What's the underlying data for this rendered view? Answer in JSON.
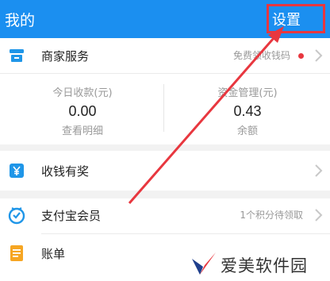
{
  "header": {
    "title": "我的",
    "settings_label": "设置"
  },
  "merchant": {
    "label": "商家服务",
    "right_text": "免费领收钱码"
  },
  "stats": {
    "today": {
      "label": "今日收款(元)",
      "value": "0.00",
      "sub": "查看明细"
    },
    "funds": {
      "label": "资金管理(元)",
      "value": "0.43",
      "sub": "余额"
    }
  },
  "reward": {
    "label": "收钱有奖"
  },
  "member": {
    "label": "支付宝会员",
    "right_text": "1个积分待领取"
  },
  "bill": {
    "label": "账单"
  },
  "watermark": {
    "text": "爱美软件园"
  },
  "colors": {
    "header_bg": "#1b8ff0",
    "highlight": "#e8373f",
    "member_icon": "#1f96e8",
    "bill_icon": "#f6a623"
  }
}
